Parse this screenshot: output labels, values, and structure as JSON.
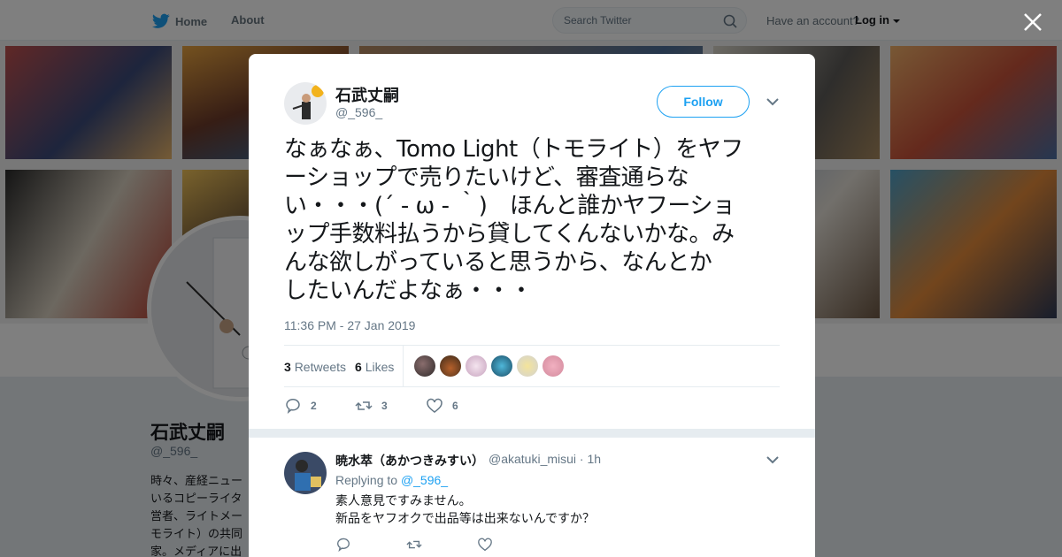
{
  "nav": {
    "home_label": "Home",
    "about_label": "About",
    "search_placeholder": "Search Twitter",
    "account_prompt": "Have an account?",
    "login_label": "Log in"
  },
  "profile": {
    "name": "石武丈嗣",
    "handle": "@_596_",
    "bio_lines": [
      "時々、産経ニュー",
      "いるコピーライタ",
      "営者、ライトメー",
      "モライト）の共同",
      "家。メディアに出"
    ]
  },
  "tweet": {
    "author_name": "石武丈嗣",
    "author_handle": "@_596_",
    "follow_label": "Follow",
    "text_lines": [
      "なぁなぁ、Tomo Light（トモライト）をヤフ",
      "ーショップで売りたいけど、審査通らな",
      "い・・・(´ - ω - ｀)　ほんと誰かヤフーショ",
      "ップ手数料払うから貸してくんないかな。み",
      "んな欲しがっていると思うから、なんとか",
      "したいんだよなぁ・・・"
    ],
    "timestamp": "11:36 PM - 27 Jan 2019",
    "retweet_count": "3",
    "retweets_label": "Retweets",
    "like_count": "6",
    "likes_label": "Likes",
    "actions": {
      "reply_count": "2",
      "retweet_count": "3",
      "like_count": "6"
    }
  },
  "reply": {
    "author_name": "暁水萃（あかつきみすい）",
    "author_handle": "@akatuki_misui",
    "time_ago": "· 1h",
    "replying_to_label": "Replying to",
    "replying_to_handle": "@_596_",
    "text_lines": [
      "素人意見ですみません。",
      "新品をヤフオクで出品等は出来ないんですか？"
    ]
  },
  "colors": {
    "accent": "#1da1f2",
    "muted": "#657786",
    "overlay": "rgba(0,0,0,0.5)"
  },
  "icons": [
    "twitter-bird-icon",
    "home-icon",
    "search-icon",
    "caret-down-icon",
    "close-icon",
    "chevron-down-icon",
    "reply-icon",
    "retweet-icon",
    "heart-icon"
  ]
}
